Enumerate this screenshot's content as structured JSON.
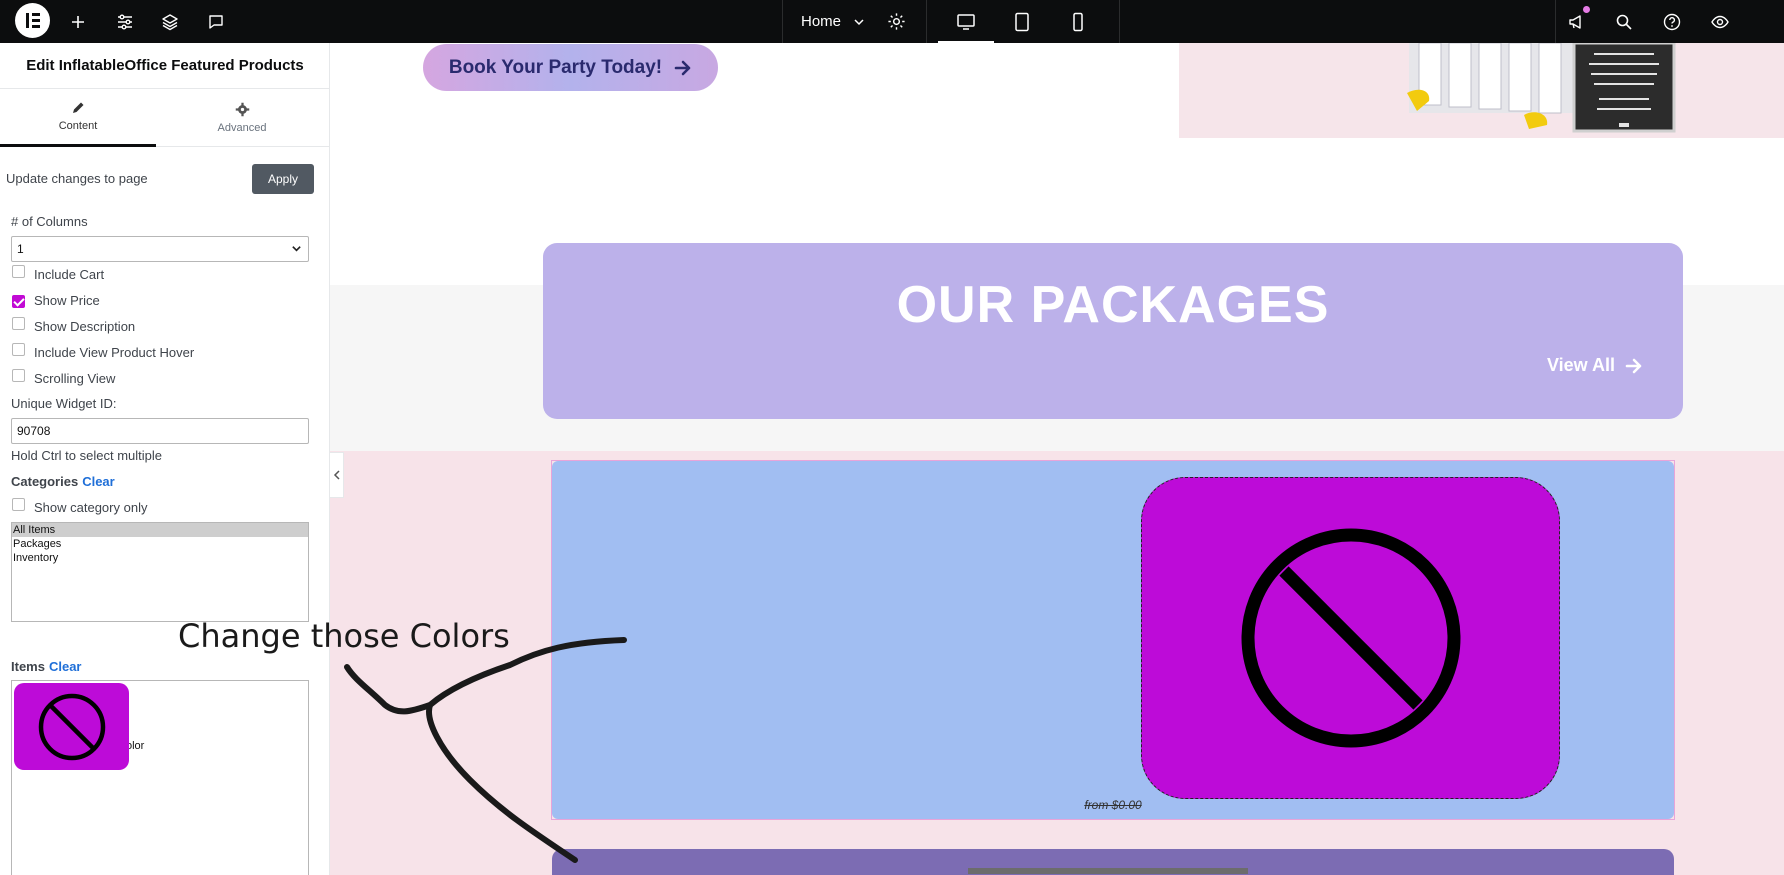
{
  "topbar": {
    "home_label": "Home",
    "icons": [
      "elementor-logo-icon",
      "plus-icon",
      "sliders-icon",
      "layers-icon",
      "comment-icon",
      "chevron-down-icon",
      "settings-gear-icon",
      "desktop-icon",
      "tablet-icon",
      "mobile-icon",
      "megaphone-icon",
      "search-icon",
      "help-icon",
      "eye-icon"
    ]
  },
  "panel": {
    "title": "Edit InflatableOffice Featured Products",
    "tabs": [
      {
        "label": "Content",
        "icon": "pencil-icon"
      },
      {
        "label": "Advanced",
        "icon": "gear-icon"
      }
    ],
    "update_label": "Update changes to page",
    "apply_label": "Apply",
    "columns_label": "# of Columns",
    "columns_value": "1",
    "checkboxes": [
      {
        "label": "Include Cart",
        "checked": false
      },
      {
        "label": "Show Price",
        "checked": true
      },
      {
        "label": "Show Description",
        "checked": false
      },
      {
        "label": "Include View Product Hover",
        "checked": false
      },
      {
        "label": "Scrolling View",
        "checked": false
      }
    ],
    "widget_id_label": "Unique Widget ID:",
    "widget_id_value": "90708",
    "hold_ctrl_hint": "Hold Ctrl to select multiple",
    "categories_label": "Categories",
    "clear_label": "Clear",
    "show_category_only_label": "Show category only",
    "categories_options": [
      "All Items",
      "Packages",
      "Inventory"
    ],
    "items_label": "Items",
    "items_fragment": "olor"
  },
  "canvas": {
    "book_button_label": "Book Your Party Today!",
    "packages_title": "OUR PACKAGES",
    "view_all_label": "View All",
    "product_caption": "from $0.00"
  },
  "annotation": {
    "text": "Change those Colors"
  },
  "colors": {
    "accent": "#bd0bd8",
    "topbar": "#0c0d0e",
    "packages_card": "#bcb1ea",
    "product_card": "#a1bef2",
    "pink_bg": "#f7e3e9"
  }
}
